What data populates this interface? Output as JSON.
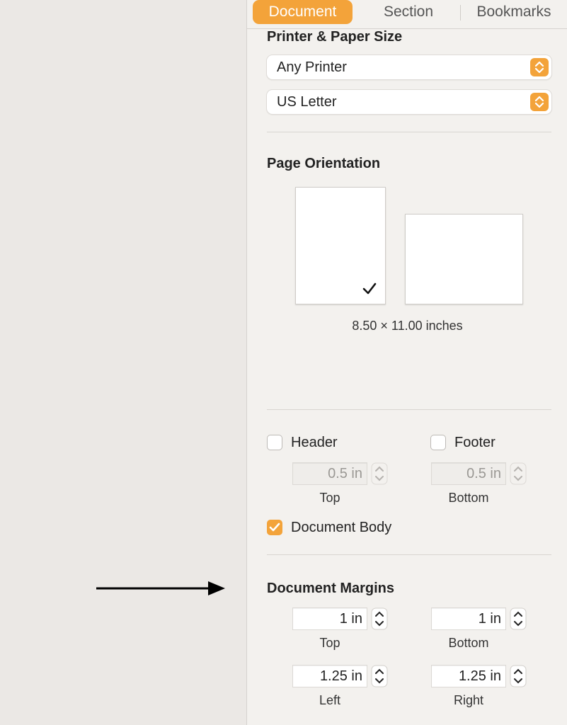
{
  "tabs": [
    {
      "label": "Document",
      "active": true
    },
    {
      "label": "Section",
      "active": false
    },
    {
      "label": "Bookmarks",
      "active": false
    }
  ],
  "printer_paper": {
    "title": "Printer & Paper Size",
    "printer": "Any Printer",
    "paper": "US Letter"
  },
  "orientation": {
    "title": "Page Orientation",
    "selected": "portrait",
    "dimensions": "8.50 × 11.00 inches"
  },
  "header_footer": {
    "header_label": "Header",
    "header_checked": false,
    "footer_label": "Footer",
    "footer_checked": false,
    "header_value": "0.5 in",
    "footer_value": "0.5 in",
    "header_pos_label": "Top",
    "footer_pos_label": "Bottom",
    "body_label": "Document Body",
    "body_checked": true
  },
  "margins": {
    "title": "Document Margins",
    "top_value": "1 in",
    "bottom_value": "1 in",
    "left_value": "1.25 in",
    "right_value": "1.25 in",
    "top_label": "Top",
    "bottom_label": "Bottom",
    "left_label": "Left",
    "right_label": "Right"
  },
  "colors": {
    "accent": "#f3a33a",
    "panel": "#f3f1ee",
    "canvas": "#ebe8e5"
  }
}
